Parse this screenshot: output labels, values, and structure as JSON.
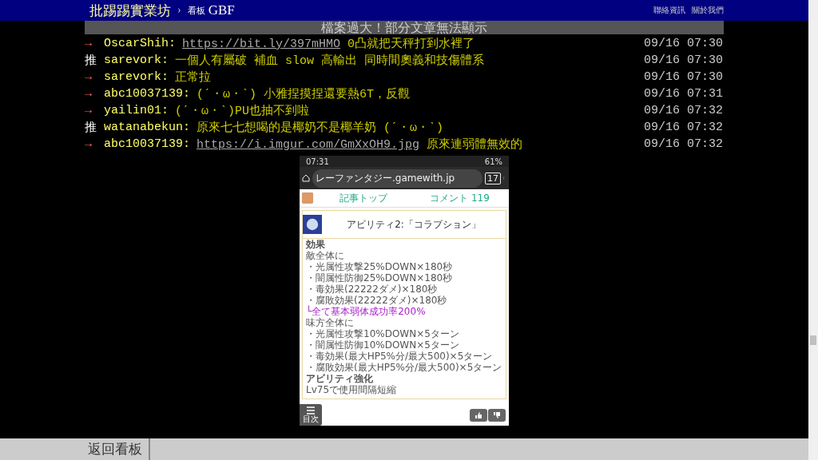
{
  "header": {
    "site": "批踢踢實業坊",
    "separator": "›",
    "board_label": "看板",
    "board": "GBF",
    "links": [
      "聯絡資訊",
      "關於我們"
    ]
  },
  "notice": "檔案過大！部分文章無法顯示",
  "pushes": [
    {
      "tag": "→",
      "kind": "arrow",
      "user": "OscarShih:",
      "parts": [
        {
          "kind": "link",
          "text": "https://bit.ly/397mHMO"
        },
        {
          "kind": "text",
          "text": " 0凸就把天秤打到水裡了"
        }
      ],
      "time": "09/16 07:30"
    },
    {
      "tag": "推",
      "kind": "push",
      "user": "sarevork:",
      "parts": [
        {
          "kind": "text",
          "text": "一個人有屬破 補血 slow 高輸出 同時間奧義和技傷體系"
        }
      ],
      "time": "09/16 07:30"
    },
    {
      "tag": "→",
      "kind": "arrow",
      "user": "sarevork:",
      "parts": [
        {
          "kind": "text",
          "text": "正常拉"
        }
      ],
      "time": "09/16 07:30"
    },
    {
      "tag": "→",
      "kind": "arrow",
      "user": "abc10037139:",
      "parts": [
        {
          "kind": "text",
          "text": "(ˊ・ω・ˋ) 小雅捏摸捏還要熱6T，反觀"
        }
      ],
      "time": "09/16 07:31"
    },
    {
      "tag": "→",
      "kind": "arrow",
      "user": "yailin01:",
      "parts": [
        {
          "kind": "text",
          "text": "(ˊ・ω・ˋ)PU也抽不到啦"
        }
      ],
      "time": "09/16 07:32"
    },
    {
      "tag": "推",
      "kind": "push",
      "user": "watanabekun:",
      "parts": [
        {
          "kind": "text",
          "text": "原來七七想喝的是椰奶不是椰羊奶 (ˊ・ω・ˋ)"
        }
      ],
      "time": "09/16 07:32"
    },
    {
      "tag": "→",
      "kind": "arrow",
      "user": "abc10037139:",
      "parts": [
        {
          "kind": "link",
          "text": "https://i.imgur.com/GmXxOH9.jpg"
        },
        {
          "kind": "text",
          "text": " 原來連弱體無效的"
        }
      ],
      "time": "09/16 07:32"
    }
  ],
  "embedded_screenshot": {
    "status_time": "07:31",
    "battery": "61%",
    "url": "レーファンタジー.gamewith.jp",
    "tab_count": "17",
    "tabs": [
      "記事トップ",
      "コメント 119"
    ],
    "section": {
      "title": "アビリティ2:「コラプション」",
      "lines": [
        {
          "kind": "heading",
          "text": "効果"
        },
        {
          "kind": "text",
          "text": "敵全体に"
        },
        {
          "kind": "text",
          "text": "・光属性攻撃25%DOWN×180秒"
        },
        {
          "kind": "text",
          "text": "・闇属性防御25%DOWN×180秒"
        },
        {
          "kind": "text",
          "text": "・毒効果(22222ダメ)×180秒"
        },
        {
          "kind": "text",
          "text": "・腐敗効果(22222ダメ)×180秒"
        },
        {
          "kind": "note",
          "text": "└全て基本弱体成功率200%"
        },
        {
          "kind": "text",
          "text": "味方全体に"
        },
        {
          "kind": "text",
          "text": "・光属性攻撃10%DOWN×5ターン"
        },
        {
          "kind": "text",
          "text": "・闇属性防御10%DOWN×5ターン"
        },
        {
          "kind": "text",
          "text": "・毒効果(最大HP5%分/最大500)×5ターン"
        },
        {
          "kind": "text",
          "text": "・腐敗効果(最大HP5%分/最大500)×5ターン"
        },
        {
          "kind": "heading",
          "text": "アビリティ強化"
        },
        {
          "kind": "text",
          "text": "Lv75で使用間隔短縮"
        }
      ]
    },
    "menu_label": "目次"
  },
  "footer": {
    "back": "返回看板"
  }
}
